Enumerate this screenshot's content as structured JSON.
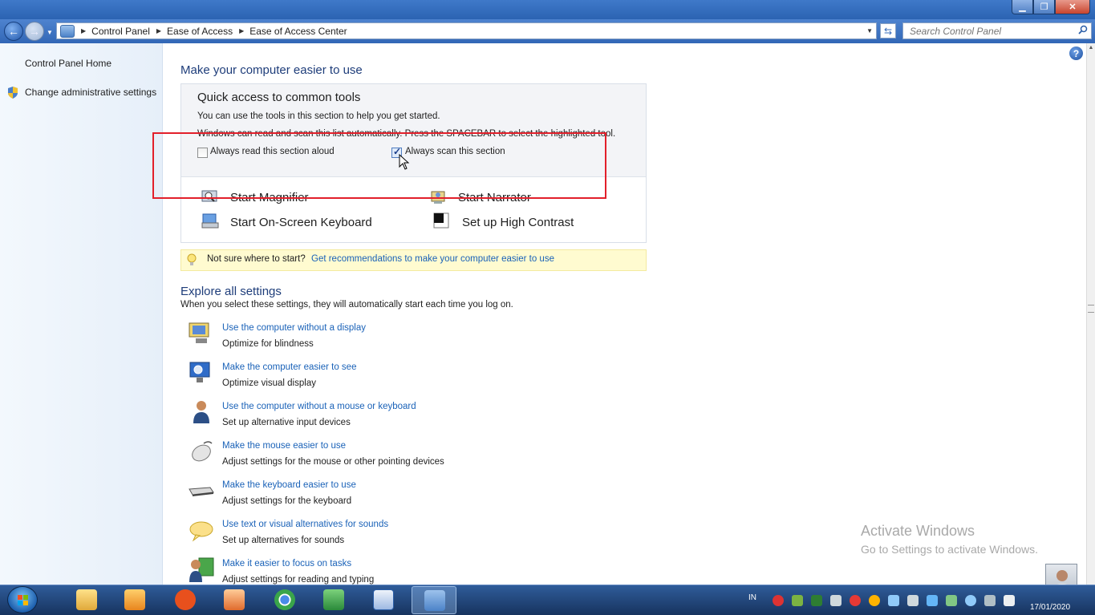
{
  "window": {
    "minimize_glyph": "▁",
    "maximize_glyph": "❐",
    "close_glyph": "✕"
  },
  "address": {
    "crumbs": [
      "Control Panel",
      "Ease of Access",
      "Ease of Access Center"
    ],
    "search_placeholder": "Search Control Panel"
  },
  "sidebar": {
    "home_label": "Control Panel Home",
    "admin_label": "Change administrative settings"
  },
  "main": {
    "heading": "Make your computer easier to use",
    "quick_access": {
      "title": "Quick access to common tools",
      "line1": "You can use the tools in this section to help you get started.",
      "line2": "Windows can read and scan this list automatically.  Press the SPACEBAR to select the highlighted tool.",
      "read_aloud_label": "Always read this section aloud",
      "read_aloud_checked": false,
      "scan_label": "Always scan this section",
      "scan_checked": true,
      "tools": {
        "magnifier": "Start Magnifier",
        "narrator": "Start Narrator",
        "keyboard": "Start On-Screen Keyboard",
        "contrast": "Set up High Contrast"
      }
    },
    "tip": {
      "text": "Not sure where to start?",
      "link": "Get recommendations to make your computer easier to use"
    },
    "explore": {
      "heading": "Explore all settings",
      "subtitle": "When you select these settings, they will automatically start each time you log on.",
      "items": [
        {
          "link": "Use the computer without a display",
          "desc": "Optimize for blindness",
          "icon": "display-speaker-icon"
        },
        {
          "link": "Make the computer easier to see",
          "desc": "Optimize visual display",
          "icon": "monitor-magnify-icon"
        },
        {
          "link": "Use the computer without a mouse or keyboard",
          "desc": "Set up alternative input devices",
          "icon": "person-icon"
        },
        {
          "link": "Make the mouse easier to use",
          "desc": "Adjust settings for the mouse or other pointing devices",
          "icon": "mouse-icon"
        },
        {
          "link": "Make the keyboard easier to use",
          "desc": "Adjust settings for the keyboard",
          "icon": "keyboard-icon"
        },
        {
          "link": "Use text or visual alternatives for sounds",
          "desc": "Set up alternatives for sounds",
          "icon": "speech-bubble-icon"
        },
        {
          "link": "Make it easier to focus on tasks",
          "desc": "Adjust settings for reading and typing",
          "icon": "focus-person-icon"
        }
      ]
    }
  },
  "watermark": {
    "line1": "Activate Windows",
    "line2": "Go to Settings to activate Windows."
  },
  "taskbar": {
    "language": "IN",
    "date": "17/01/2020",
    "apps": [
      "file-explorer-icon",
      "media-player-icon",
      "orange-app-icon",
      "presentation-icon",
      "chrome-icon",
      "excel-icon",
      "word-icon",
      "control-panel-icon"
    ],
    "active_app": "control-panel-icon"
  },
  "colors": {
    "link": "#1a62b8",
    "heading": "#1e3d7a",
    "highlight_box": "#e2202b",
    "tip_bg": "#fffbd0"
  }
}
